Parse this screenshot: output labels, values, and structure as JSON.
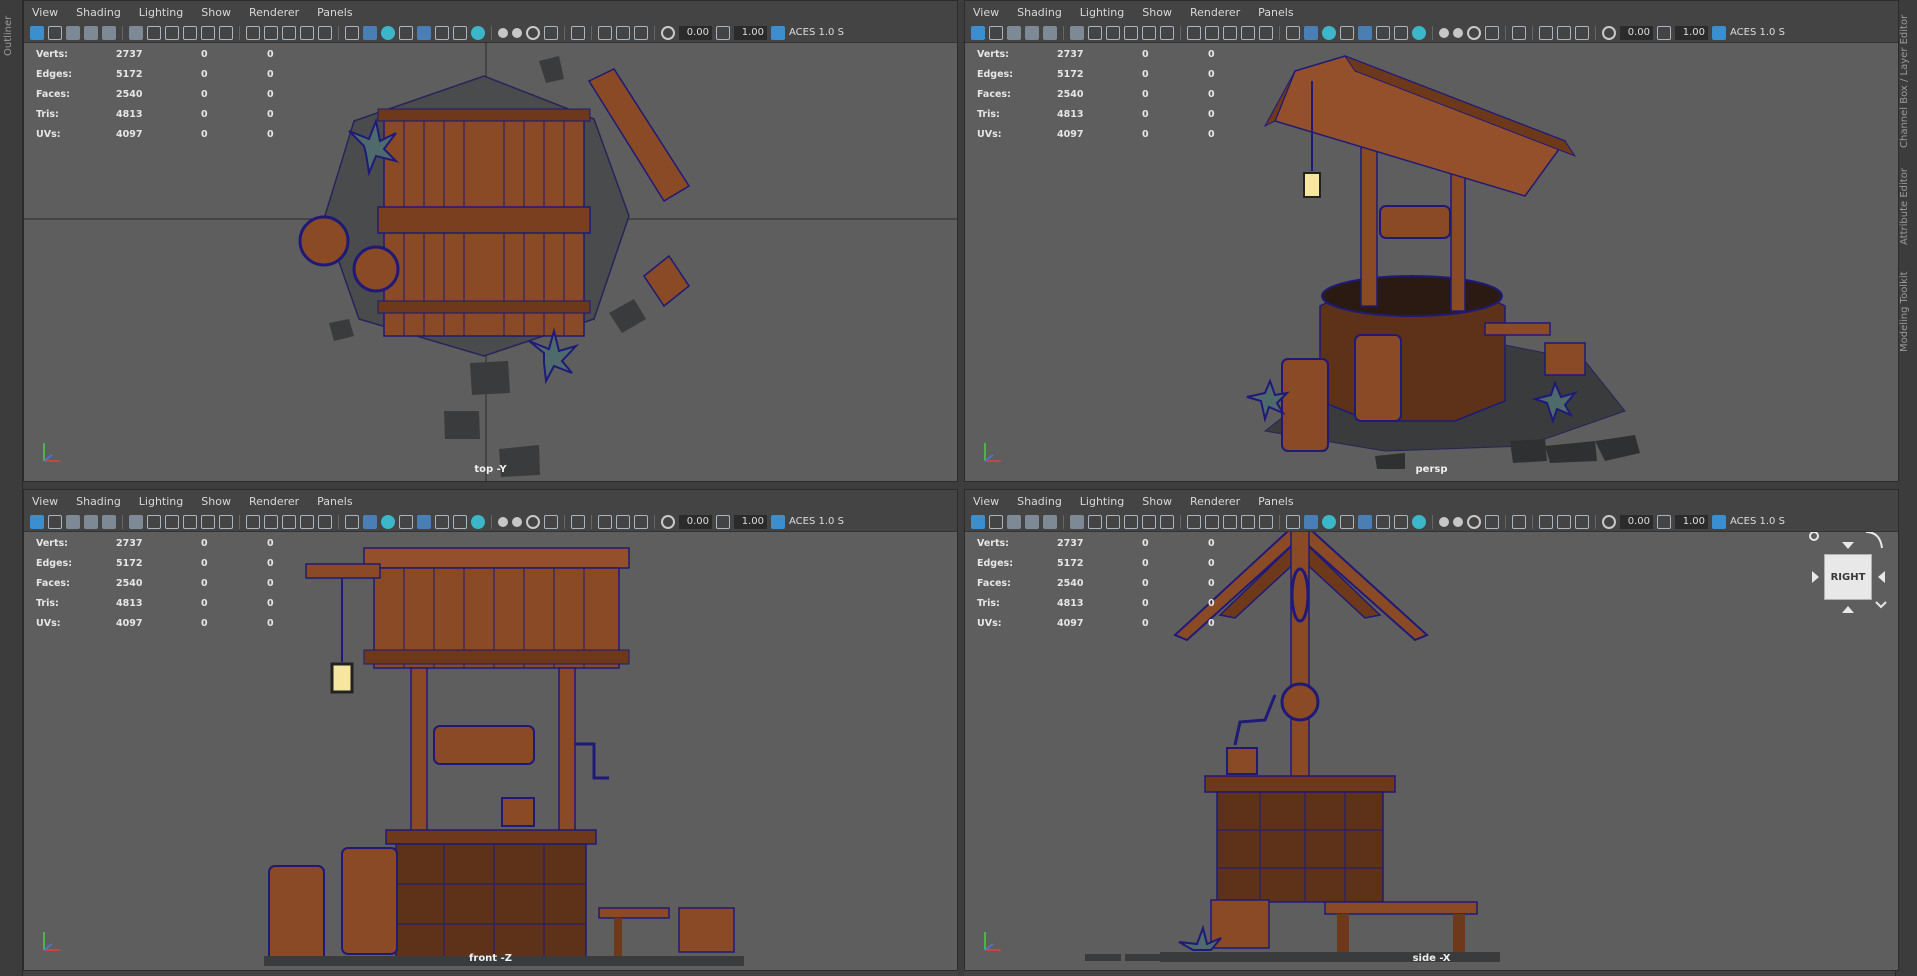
{
  "side_tabs": {
    "left": [
      "Outliner"
    ],
    "right": [
      "Channel Box / Layer Editor",
      "Attribute Editor",
      "Modeling Toolkit"
    ]
  },
  "menus": [
    "View",
    "Shading",
    "Lighting",
    "Show",
    "Renderer",
    "Panels"
  ],
  "toolbar": {
    "exposure": "0.00",
    "gamma": "1.00",
    "color_space": "ACES 1.0 S"
  },
  "hud": {
    "rows": [
      {
        "label": "Verts:",
        "object": "2737",
        "selected": "0",
        "component": "0"
      },
      {
        "label": "Edges:",
        "object": "5172",
        "selected": "0",
        "component": "0"
      },
      {
        "label": "Faces:",
        "object": "2540",
        "selected": "0",
        "component": "0"
      },
      {
        "label": "Tris:",
        "object": "4813",
        "selected": "0",
        "component": "0"
      },
      {
        "label": "UVs:",
        "object": "4097",
        "selected": "0",
        "component": "0"
      }
    ]
  },
  "viewports": {
    "top": {
      "camera": "top -Y"
    },
    "persp": {
      "camera": "persp"
    },
    "front": {
      "camera": "front -Z"
    },
    "side": {
      "camera": "side -X"
    }
  },
  "viewcube": {
    "face": "RIGHT"
  },
  "colors": {
    "viewport_bg": "#5e5e5e",
    "wood": "#8a4a26",
    "wood_dark": "#5a2e17",
    "wireframe": "#1f1a78",
    "stone": "#3a3b3c",
    "lantern_glow": "#f7e6a0"
  }
}
